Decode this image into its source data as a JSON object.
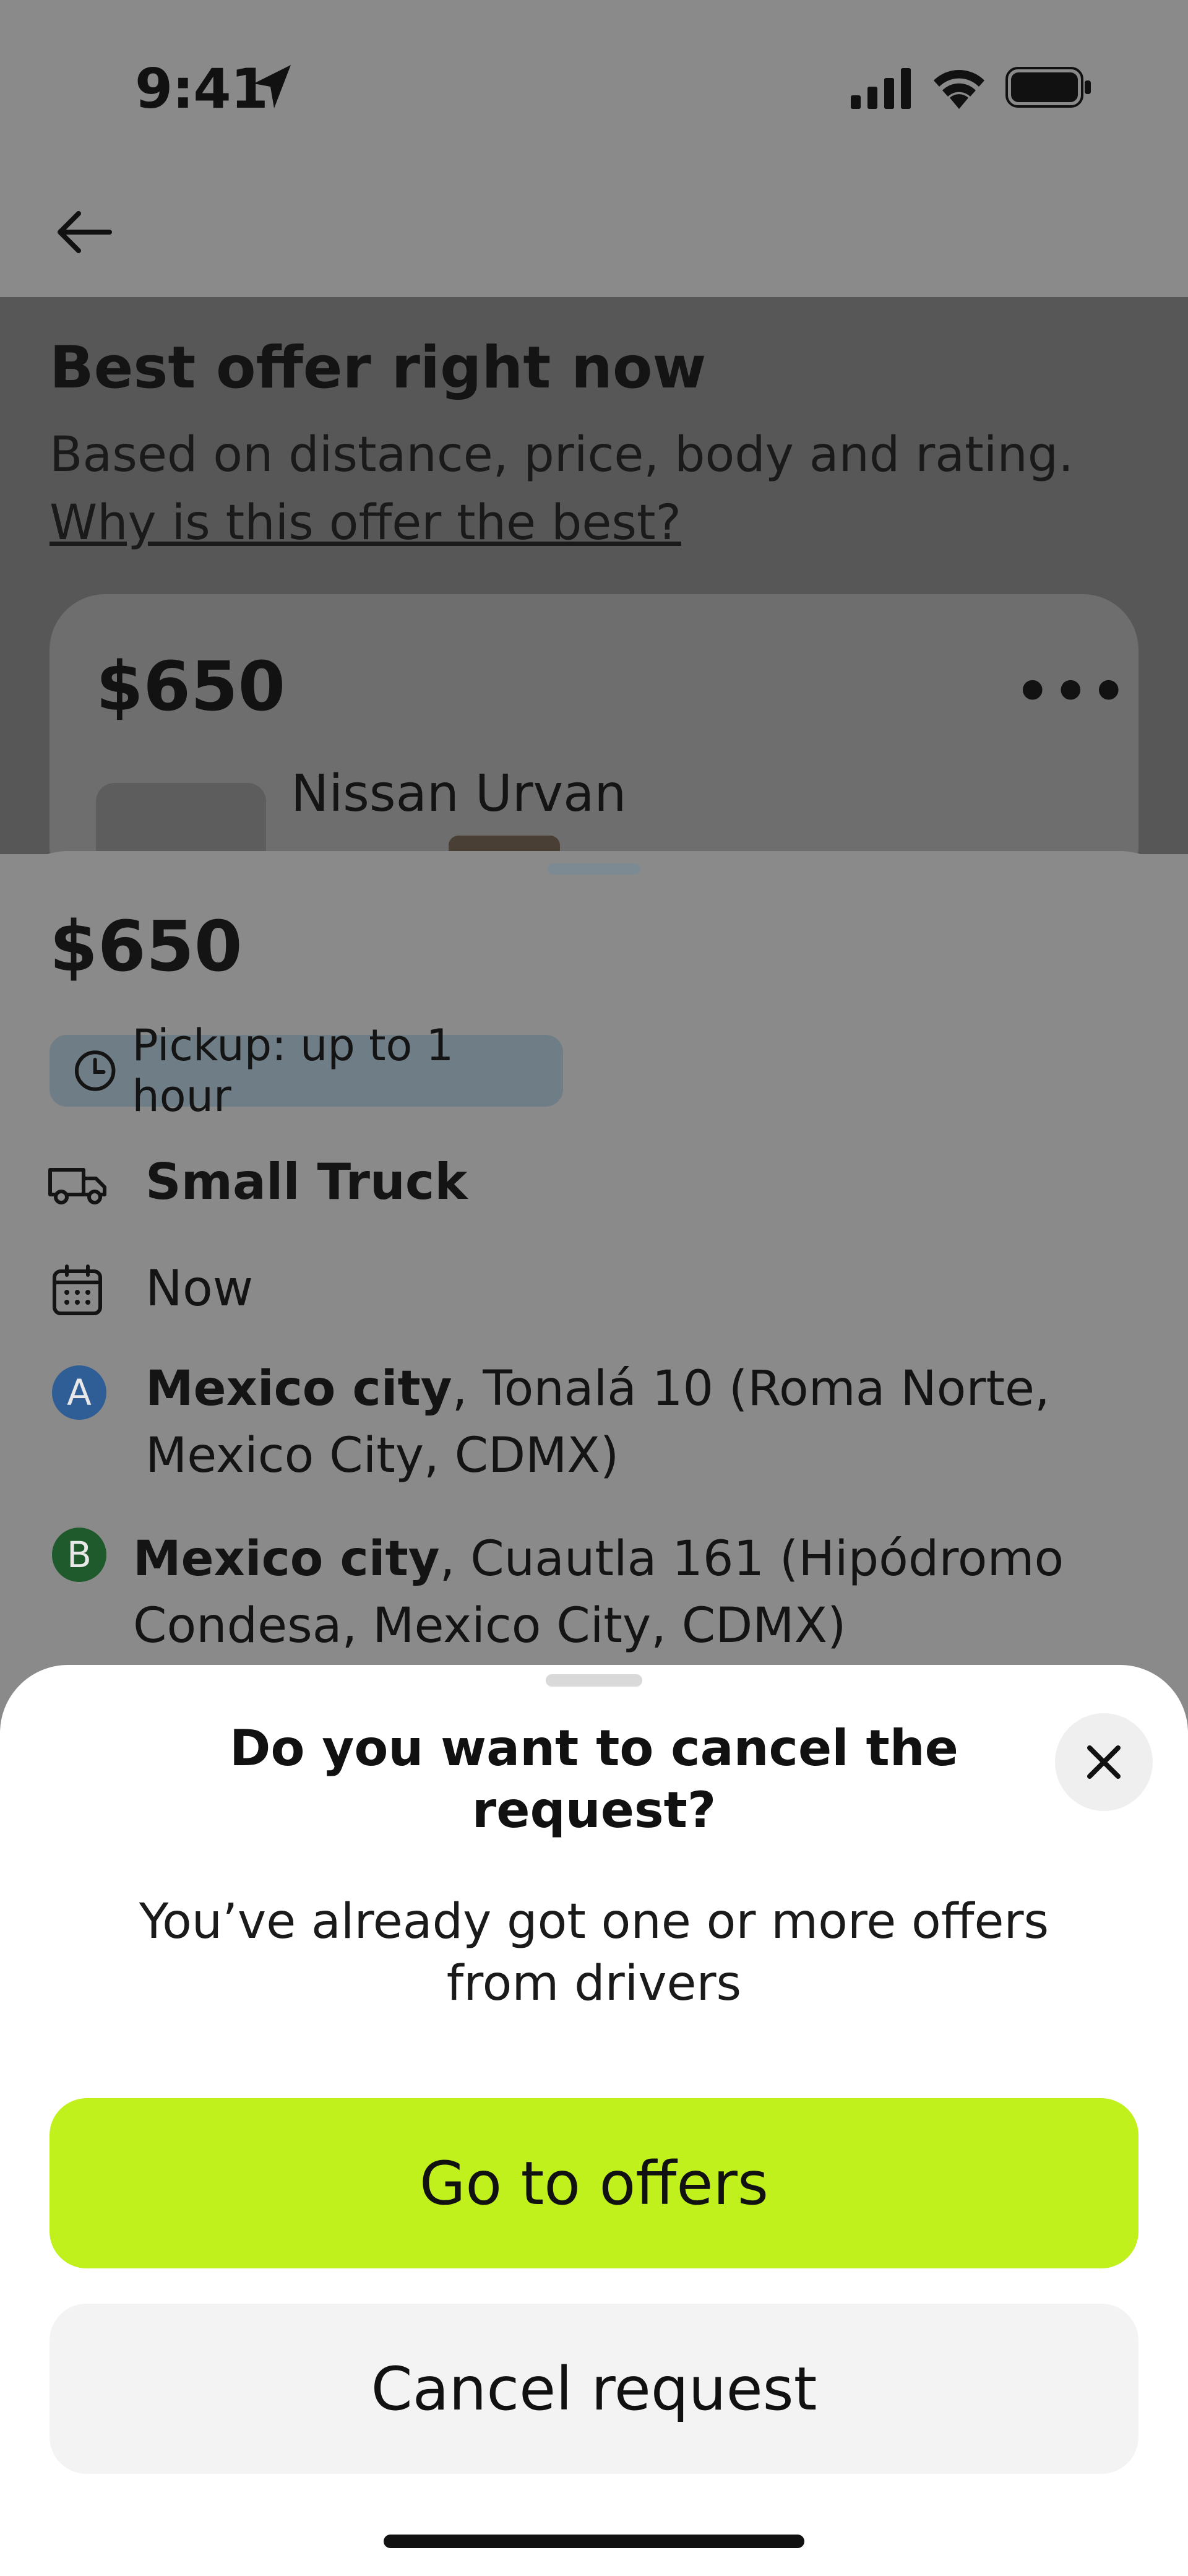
{
  "status_bar": {
    "time": "9:41"
  },
  "background": {
    "title": "Best offer right now",
    "subtitle": "Based on distance, price, body and rating.",
    "link": "Why is this offer the best?",
    "card_price": "$650",
    "card_more": "•••",
    "card_vehicle": "Nissan Urvan"
  },
  "offer": {
    "price": "$650",
    "pickup": "Pickup: up to 1 hour",
    "vehicle_type": "Small Truck",
    "schedule": "Now",
    "pin_a": "A",
    "pin_b": "B",
    "address_a_city": "Mexico city",
    "address_a_rest": ", Tonalá 10 (Roma Norte, Mexico City, CDMX)",
    "address_b_city": "Mexico city",
    "address_b_rest": ", Cuautla 161 (Hipódromo Condesa, Mexico City, CDMX)"
  },
  "modal": {
    "title": "Do you want to cancel the request?",
    "description": "You’ve already got one or more offers from drivers",
    "primary_label": "Go to offers",
    "secondary_label": "Cancel request"
  },
  "colors": {
    "accent": "#c1f11d",
    "pin_a": "#2f5d96",
    "pin_b": "#1f5a2c"
  }
}
